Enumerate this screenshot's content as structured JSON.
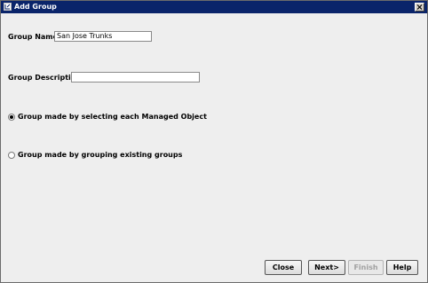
{
  "window": {
    "title": "Add Group"
  },
  "form": {
    "group_name_label": "Group Name",
    "required_mark": "*",
    "group_name_value": "San Jose Trunks",
    "group_description_label": "Group Description",
    "group_description_value": "",
    "radio_options": [
      {
        "label": "Group made by selecting each Managed Object",
        "selected": true
      },
      {
        "label": "Group made by grouping existing groups",
        "selected": false
      }
    ]
  },
  "buttons": {
    "close": "Close",
    "next": "Next>",
    "finish": "Finish",
    "help": "Help"
  }
}
